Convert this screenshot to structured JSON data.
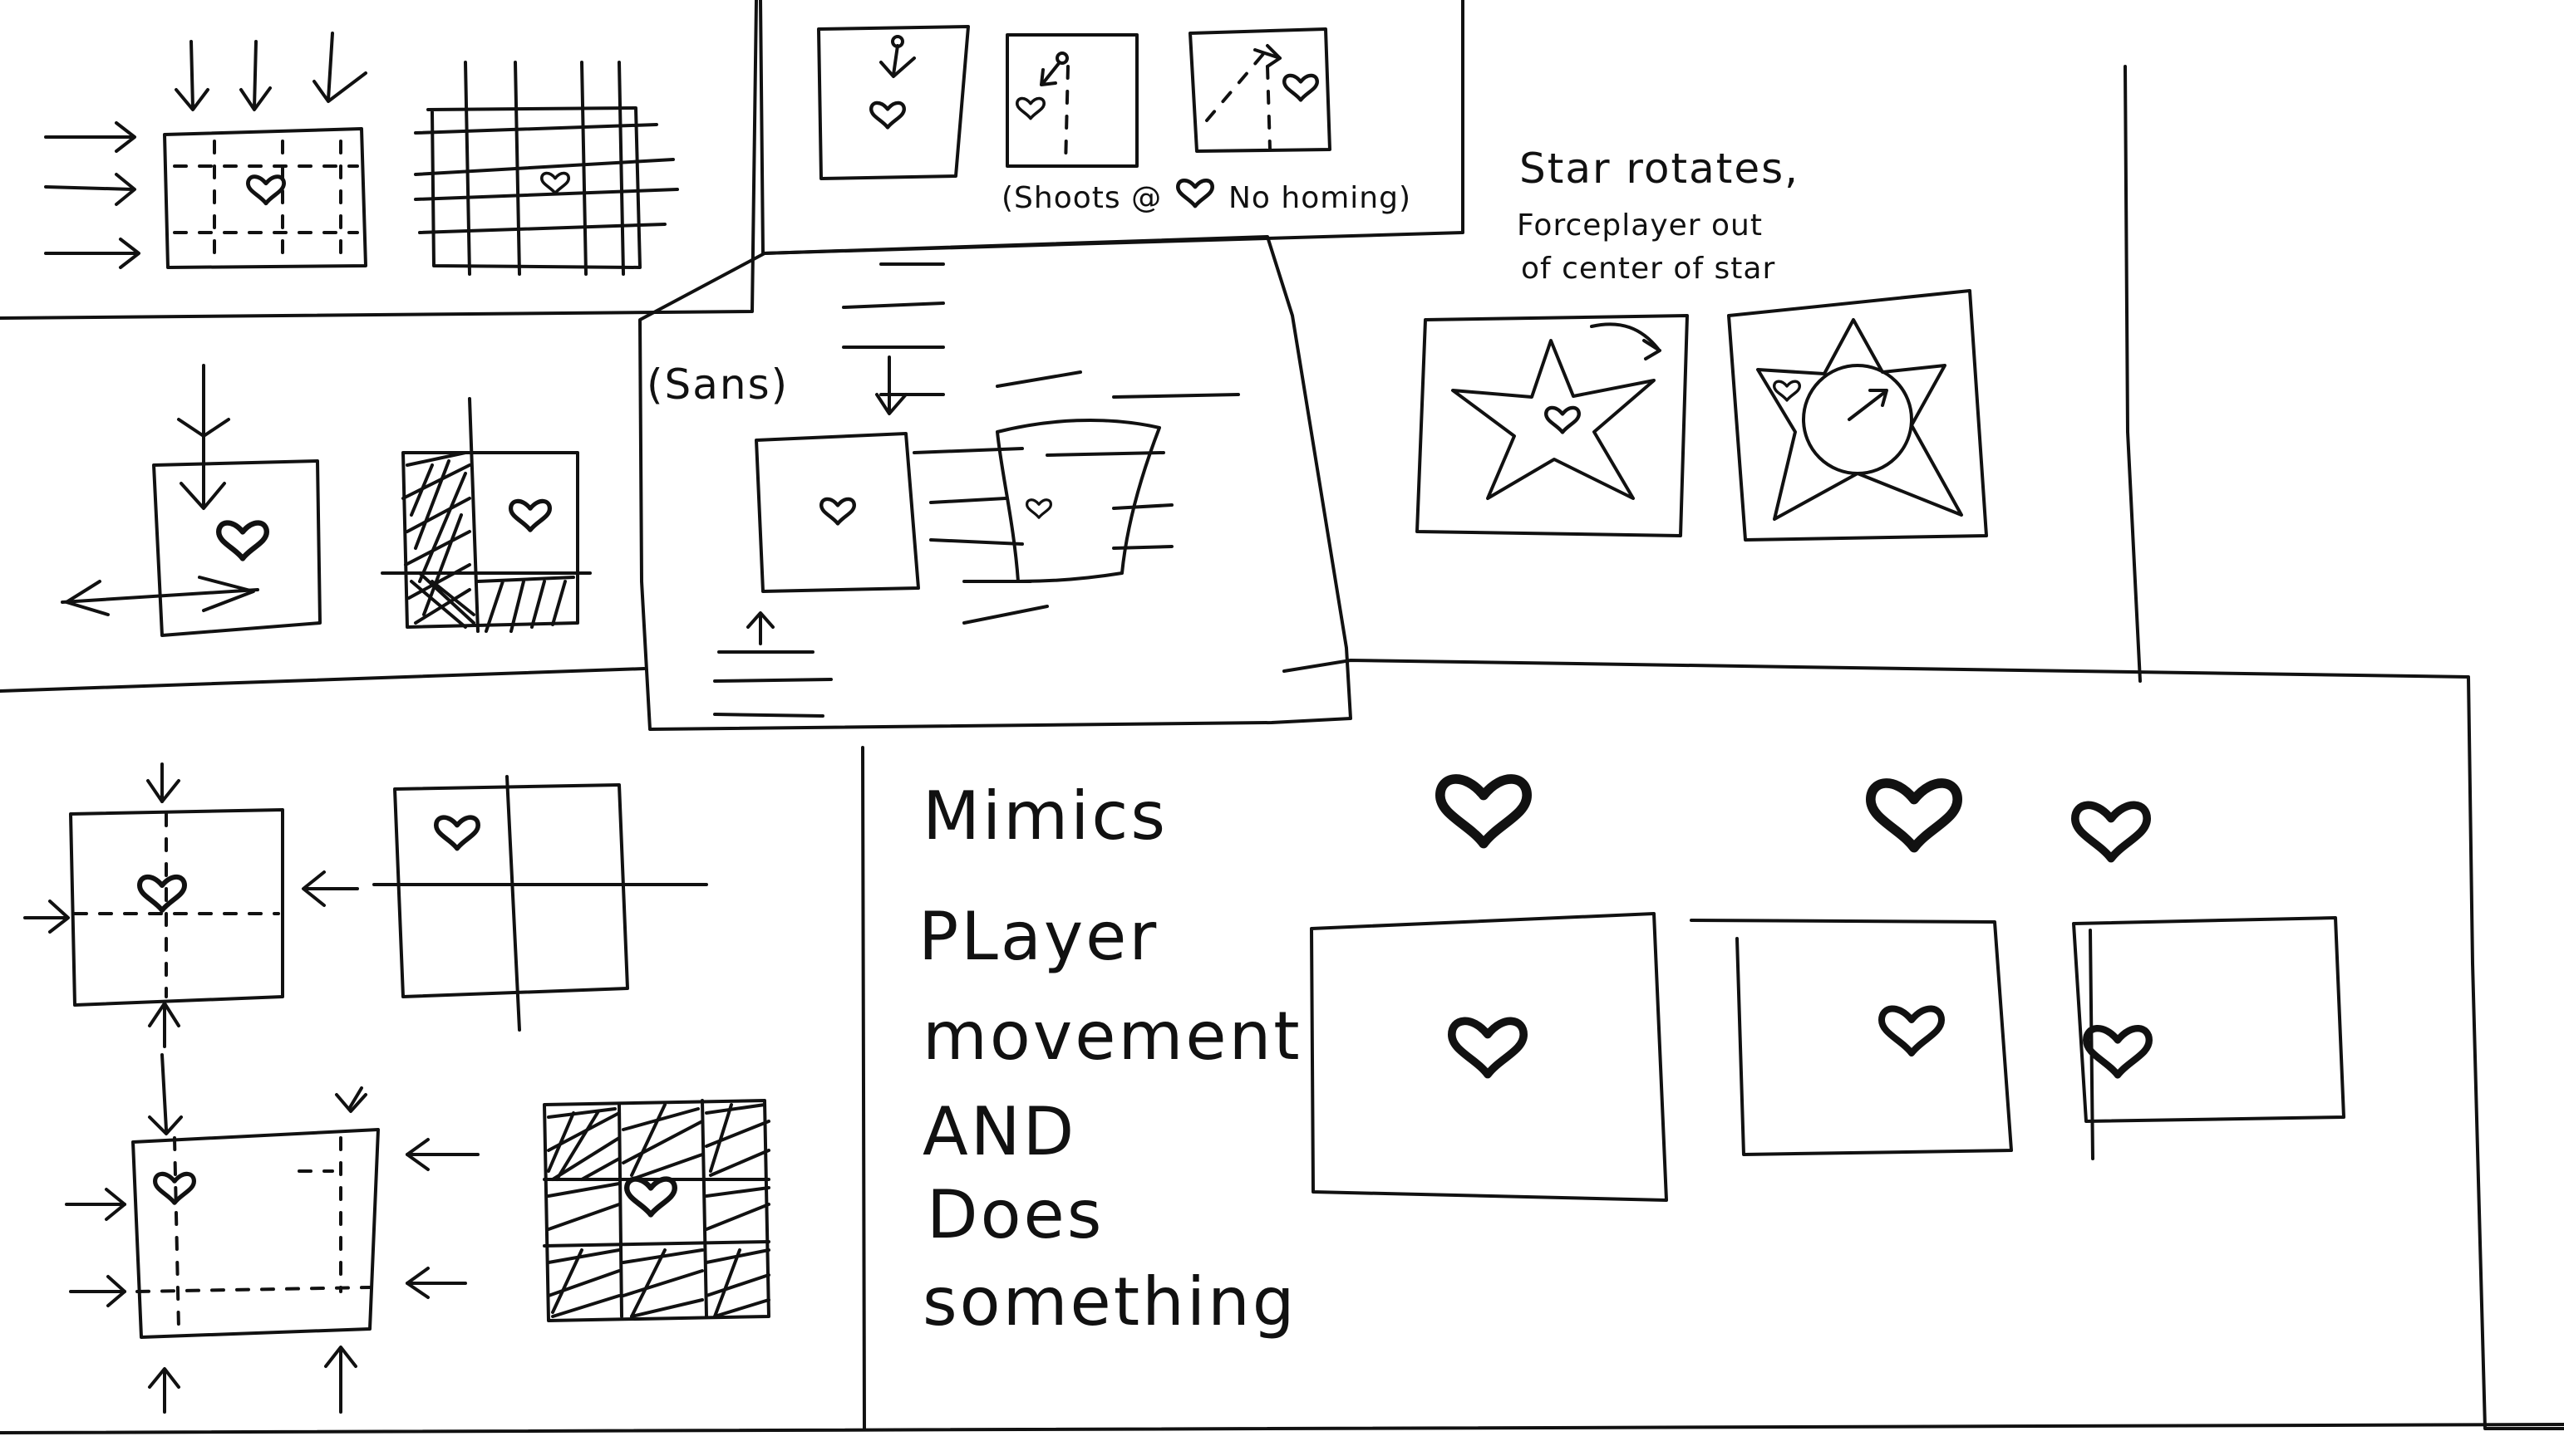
{
  "notes": {
    "sans": "(Sans)",
    "shoots_note": "(Shoots @",
    "shoots_note_tail": "No homing)",
    "star_l1": "Star rotates,",
    "star_l2": "Forceplayer out",
    "star_l3": "of center of star",
    "mimics_l1": "Mimics",
    "mimics_l2": "PLayer",
    "mimics_l3": "movement",
    "mimics_l4": "AND",
    "mimics_l5": "Does",
    "mimics_l6": "something"
  },
  "icons": {
    "heart": "heart-icon",
    "arrow": "arrow-icon",
    "star": "star-icon"
  },
  "colors": {
    "ink": "#111111",
    "heart": "#e0141b",
    "paper": "#ffffff"
  }
}
